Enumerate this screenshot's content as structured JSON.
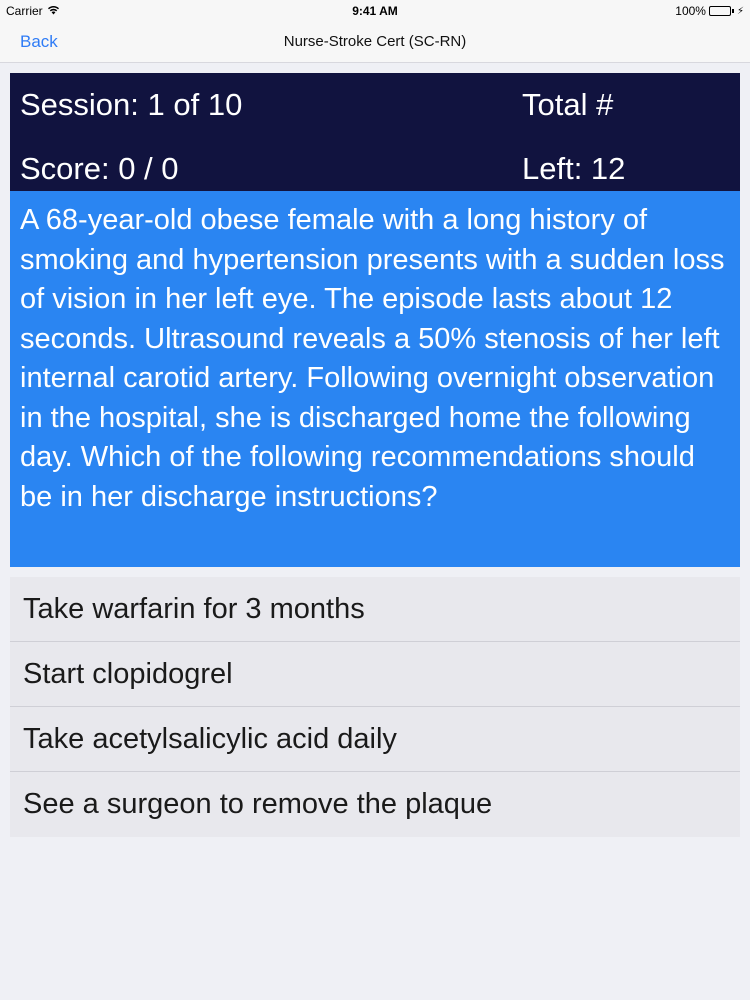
{
  "status_bar": {
    "carrier": "Carrier",
    "wifi_icon": "wifi-icon",
    "time": "9:41 AM",
    "battery": "100%",
    "battery_level": 1.0
  },
  "nav": {
    "back_label": "Back",
    "title": "Nurse-Stroke Cert (SC-RN)"
  },
  "header": {
    "session": "Session: 1 of 10",
    "total": "Total #",
    "score": "Score: 0 / 0",
    "left": "Left: 12"
  },
  "question": {
    "text": "A 68-year-old obese female with a long history of smoking and hypertension presents with a sudden loss of vision in her left eye. The episode lasts about 12 seconds. Ultrasound reveals a 50% stenosis of her left internal carotid artery. Following overnight observation in the hospital, she is discharged home the following day. Which of the following recommendations should be in her discharge instructions?"
  },
  "answers": [
    {
      "label": "Take warfarin for 3 months"
    },
    {
      "label": "Start clopidogrel"
    },
    {
      "label": "Take acetylsalicylic acid daily"
    },
    {
      "label": "See a surgeon to remove the plaque"
    }
  ],
  "colors": {
    "header_bg": "#11133f",
    "question_bg": "#2a85f2",
    "accent": "#2f7cf6",
    "background": "#eff0f5"
  }
}
